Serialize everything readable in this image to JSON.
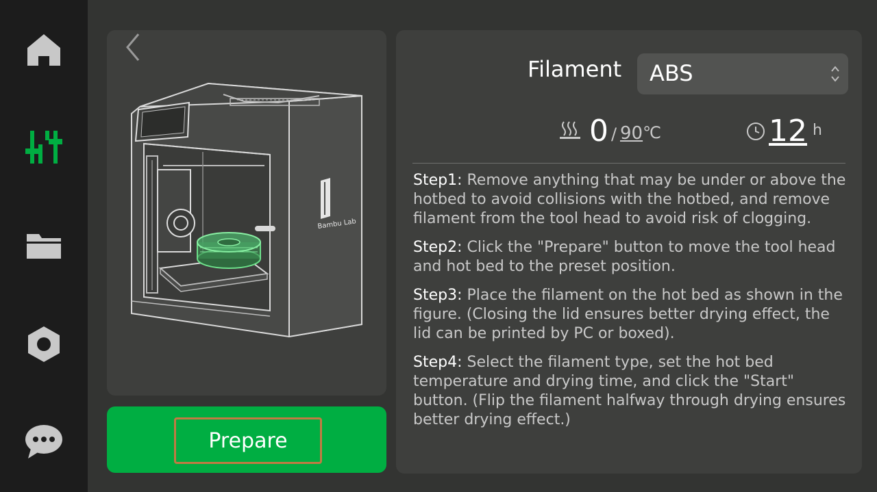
{
  "sidebar": {
    "items": [
      {
        "name": "home",
        "icon": "home-icon",
        "active": false
      },
      {
        "name": "controls",
        "icon": "sliders-icon",
        "active": true
      },
      {
        "name": "files",
        "icon": "folder-icon",
        "active": false
      },
      {
        "name": "settings",
        "icon": "hex-nut-icon",
        "active": false
      },
      {
        "name": "messages",
        "icon": "chat-icon",
        "active": false
      }
    ],
    "active_color": "#00ae42",
    "inactive_color": "#c8c8c8"
  },
  "illustration": {
    "brand_text": "Bambu Lab"
  },
  "prepare_button": {
    "label": "Prepare",
    "color": "#00ae42"
  },
  "filament": {
    "label": "Filament",
    "selected": "ABS"
  },
  "temperature": {
    "current": "0",
    "separator": "/",
    "target": "90",
    "unit": "℃"
  },
  "drying_time": {
    "value": "12",
    "unit": "h"
  },
  "steps": [
    {
      "title": "Step1:",
      "text": " Remove anything that may be under or above the hotbed to avoid collisions with the hotbed, and remove filament from the tool head to avoid risk of clogging."
    },
    {
      "title": "Step2:",
      "text": " Click the \"Prepare\" button to move the tool head and hot bed to the preset position."
    },
    {
      "title": "Step3:",
      "text": " Place the filament on the hot bed as shown in the figure. (Closing the lid ensures better drying effect, the lid can be printed by PC or boxed)."
    },
    {
      "title": "Step4:",
      "text": " Select the filament type, set the hot bed temperature and drying time, and click the \"Start\" button. (Flip the filament halfway through drying ensures better drying effect.)"
    }
  ]
}
